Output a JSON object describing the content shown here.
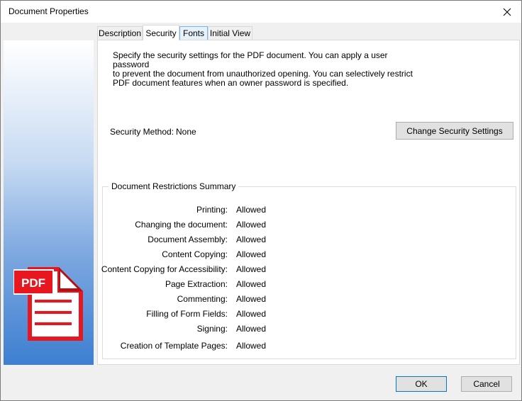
{
  "window": {
    "title": "Document Properties"
  },
  "tabs": [
    {
      "label": "Description"
    },
    {
      "label": "Security"
    },
    {
      "label": "Fonts"
    },
    {
      "label": "Initial View"
    }
  ],
  "security": {
    "description_lines": [
      "Specify the security settings for the PDF document. You can apply a user password",
      "to prevent the document from unauthorized opening. You can selectively restrict",
      "PDF document features when an owner password is specified."
    ],
    "method_label": "Security Method:",
    "method_value": "None",
    "change_button": "Change Security Settings"
  },
  "restrictions": {
    "title": "Document Restrictions Summary",
    "rows": [
      {
        "label": "Printing:",
        "value": "Allowed"
      },
      {
        "label": "Changing the document:",
        "value": "Allowed"
      },
      {
        "label": "Document Assembly:",
        "value": "Allowed"
      },
      {
        "label": "Content Copying:",
        "value": "Allowed"
      },
      {
        "label": "Content Copying for Accessibility:",
        "value": "Allowed"
      },
      {
        "label": "Page Extraction:",
        "value": "Allowed"
      },
      {
        "label": "Commenting:",
        "value": "Allowed"
      },
      {
        "label": "Filling of Form Fields:",
        "value": "Allowed"
      },
      {
        "label": "Signing:",
        "value": "Allowed"
      },
      {
        "label": "Creation of Template Pages:",
        "value": "Allowed"
      }
    ]
  },
  "sidebar": {
    "icon": "pdf-file-icon",
    "icon_badge": "PDF",
    "icon_color": "#e8171f"
  },
  "footer": {
    "ok_label": "OK",
    "cancel_label": "Cancel"
  },
  "colors": {
    "accent": "#0078d7",
    "button_face": "#e1e1e1"
  }
}
